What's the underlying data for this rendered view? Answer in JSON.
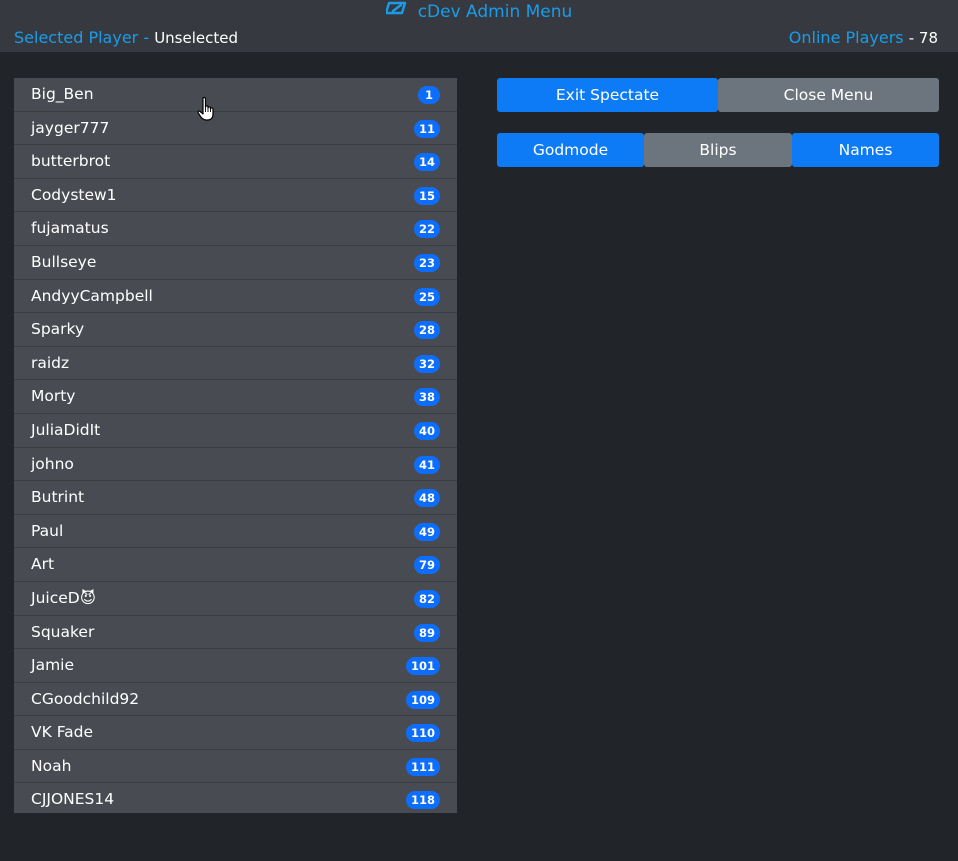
{
  "header": {
    "title": "cDev Admin Menu",
    "selected_player_label": "Selected Player -",
    "selected_player_value": "Unselected",
    "online_players_label": "Online Players",
    "online_players_value": "- 78"
  },
  "players": [
    {
      "name": "Big_Ben",
      "id": "1"
    },
    {
      "name": "jayger777",
      "id": "11"
    },
    {
      "name": "butterbrot",
      "id": "14"
    },
    {
      "name": "Codystew1",
      "id": "15"
    },
    {
      "name": "fujamatus",
      "id": "22"
    },
    {
      "name": "Bullseye",
      "id": "23"
    },
    {
      "name": "AndyyCampbell",
      "id": "25"
    },
    {
      "name": "Sparky",
      "id": "28"
    },
    {
      "name": "raidz",
      "id": "32"
    },
    {
      "name": "Morty",
      "id": "38"
    },
    {
      "name": "JuliaDidIt",
      "id": "40"
    },
    {
      "name": "johno",
      "id": "41"
    },
    {
      "name": "Butrint",
      "id": "48"
    },
    {
      "name": "Paul",
      "id": "49"
    },
    {
      "name": "Art",
      "id": "79"
    },
    {
      "name": "JuiceD😈",
      "id": "82"
    },
    {
      "name": "Squaker",
      "id": "89"
    },
    {
      "name": "Jamie",
      "id": "101"
    },
    {
      "name": "CGoodchild92",
      "id": "109"
    },
    {
      "name": "VK Fade",
      "id": "110"
    },
    {
      "name": "Noah",
      "id": "111"
    },
    {
      "name": "CJJONES14",
      "id": "118"
    }
  ],
  "actions": {
    "exit_spectate": "Exit Spectate",
    "close_menu": "Close Menu",
    "godmode": "Godmode",
    "blips": "Blips",
    "names": "Names"
  },
  "colors": {
    "accent": "#1a9ce8",
    "button_active": "#0d7bf5",
    "button_inactive": "#6c757d",
    "badge": "#0d6efd"
  },
  "icons": {
    "logo": "cdev-logo-icon",
    "cursor": "hand-pointer-icon"
  }
}
